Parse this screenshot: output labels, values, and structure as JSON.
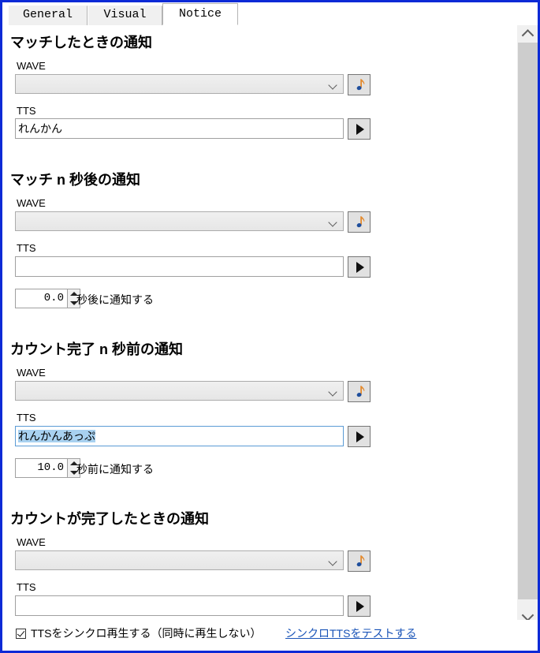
{
  "window": {
    "border_color": "#0c2ad6"
  },
  "tabs": [
    {
      "id": "general",
      "label": "General",
      "active": false
    },
    {
      "id": "visual",
      "label": "Visual",
      "active": false
    },
    {
      "id": "notice",
      "label": "Notice",
      "active": true
    }
  ],
  "sections": [
    {
      "id": "on-match",
      "heading": "マッチしたときの通知",
      "wave_label": "WAVE",
      "wave_value": "",
      "wave_button_icon": "music-note-icon",
      "tts_label": "TTS",
      "tts_value": "れんかん",
      "tts_selected": false,
      "tts_focused": false,
      "tts_button_icon": "play-icon",
      "has_spinner": false
    },
    {
      "id": "n-sec-after-match",
      "heading": "マッチ n 秒後の通知",
      "wave_label": "WAVE",
      "wave_value": "",
      "wave_button_icon": "music-note-icon",
      "tts_label": "TTS",
      "tts_value": "",
      "tts_selected": false,
      "tts_focused": false,
      "tts_button_icon": "play-icon",
      "has_spinner": true,
      "spinner_value": "0.0",
      "spinner_suffix": "秒後に通知する"
    },
    {
      "id": "n-sec-before-count-end",
      "heading": "カウント完了 n 秒前の通知",
      "wave_label": "WAVE",
      "wave_value": "",
      "wave_button_icon": "music-note-icon",
      "tts_label": "TTS",
      "tts_value": "れんかんあっぷ",
      "tts_selected": true,
      "tts_focused": true,
      "tts_button_icon": "play-icon",
      "has_spinner": true,
      "spinner_value": "10.0",
      "spinner_suffix": "秒前に通知する"
    },
    {
      "id": "count-completed",
      "heading": "カウントが完了したときの通知",
      "wave_label": "WAVE",
      "wave_value": "",
      "wave_button_icon": "music-note-icon",
      "tts_label": "TTS",
      "tts_value": "",
      "tts_selected": false,
      "tts_focused": false,
      "tts_button_icon": "play-icon",
      "has_spinner": false
    }
  ],
  "scrollbar": {
    "up_icon": "chevron-up-icon",
    "down_icon": "chevron-down-icon",
    "orientation": "vertical"
  },
  "bottom": {
    "sync_checkbox_checked": true,
    "sync_label": "TTSをシンクロ再生する（同時に再生しない）",
    "sync_test_link": "シンクロTTSをテストする",
    "link_color": "#1a54b8"
  }
}
